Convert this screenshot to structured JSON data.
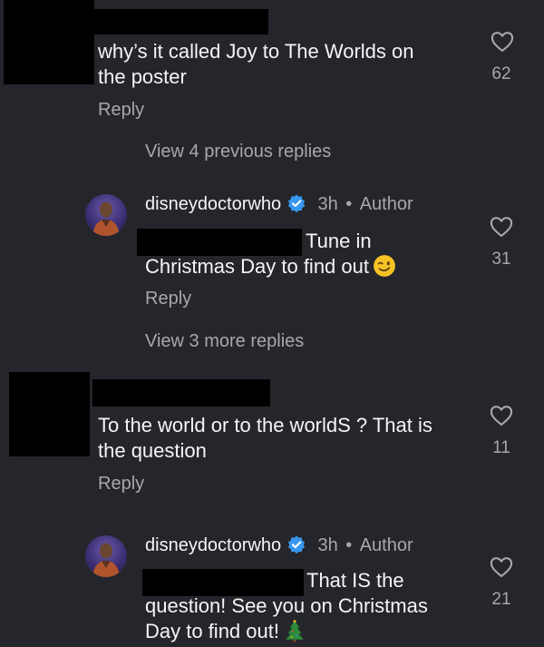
{
  "comments": [
    {
      "text_lines": [
        "why’s it called Joy to The Worlds on",
        "the poster"
      ],
      "likes": "62",
      "reply_label": "Reply",
      "view_replies": "View 4 previous replies"
    },
    {
      "username": "disneydoctorwho",
      "time": "3h",
      "separator": "•",
      "badge": "Author",
      "text_line1_tail": "Tune in",
      "text_line2": "Christmas Day to find out",
      "emoji": "winking-face",
      "likes": "31",
      "reply_label": "Reply",
      "view_replies": "View 3 more replies"
    },
    {
      "text_lines": [
        "To the world or to the worldS ? That is",
        "the question"
      ],
      "likes": "11",
      "reply_label": "Reply"
    },
    {
      "username": "disneydoctorwho",
      "time": "3h",
      "separator": "•",
      "badge": "Author",
      "text_line1_tail": "That IS the",
      "text_line2": "question! See you on Christmas",
      "text_line3": "Day to find out!",
      "emoji": "christmas-tree",
      "likes": "21"
    }
  ]
}
